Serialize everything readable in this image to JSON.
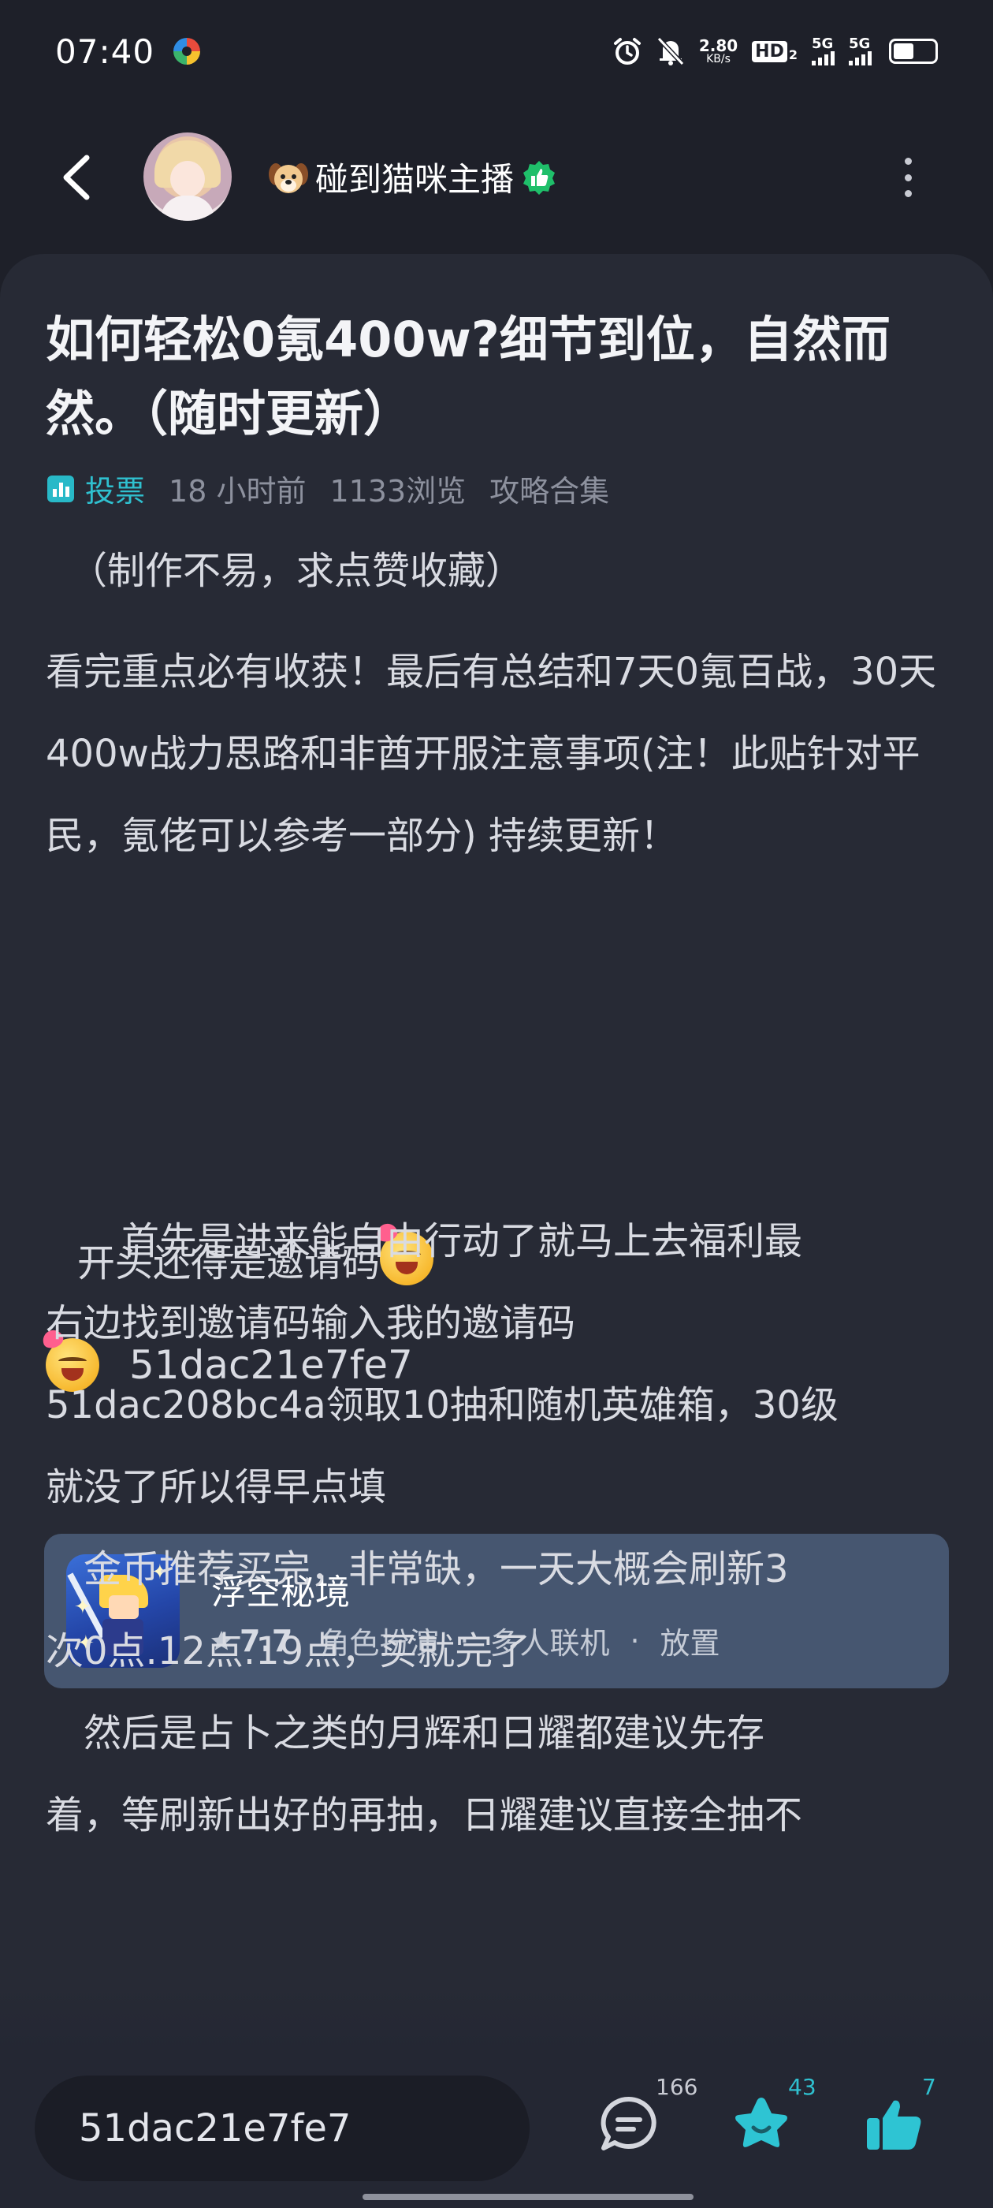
{
  "status_bar": {
    "time": "07:40",
    "net_speed_value": "2.80",
    "net_speed_unit": "KB/s",
    "hd_label": "HD",
    "hd_sub": "2",
    "signal1": "5G",
    "signal2": "5G",
    "battery_level": 0.5,
    "icons": [
      "app-icon",
      "alarm-icon",
      "mute-bell-icon",
      "signal-icon",
      "battery-icon"
    ]
  },
  "header": {
    "author_name": "碰到猫咪主播",
    "icons": [
      "back-arrow-icon",
      "avatar",
      "dog-emoji-icon",
      "verified-badge-icon",
      "more-vertical-icon"
    ]
  },
  "post": {
    "title": "如何轻松0氪400w?细节到位，自然而然。（随时更新）",
    "meta": {
      "type_label": "投票",
      "time": "18 小时前",
      "views": "1133浏览",
      "collection": "攻略合集"
    },
    "p1": "（制作不易，求点赞收藏）",
    "p2": "看完重点必有收获！最后有总结和7天0氪百战，30天400w战力思路和非酋开服注意事项(注！此贴针对平民，氪佬可以参考一部分) 持续更新！",
    "invite_intro": "开头还得是邀请码",
    "invite_code": "51dac21e7fe7",
    "p3_lines": [
      "　　首先是进来能自由行动了就马上去福利最",
      "右边找到邀请码输入我的邀请码",
      "51dac208bc4a领取10抽和随机英雄箱，30级",
      "就没了所以得早点填",
      "　金币推荐买完，非常缺，一天大概会刷新3",
      "次0点.12点.19点，买就完了",
      "　然后是占卜之类的月辉和日耀都建议先存",
      "着，等刷新出好的再抽，日耀建议直接全抽不"
    ]
  },
  "game_card": {
    "name": "浮空秘境",
    "rating": "7.7",
    "tags": [
      "角色扮演",
      "多人联机",
      "放置"
    ],
    "separator": "·"
  },
  "bottom_bar": {
    "input_value": "51dac21e7fe7",
    "comment_count": "166",
    "favorite_count": "43",
    "like_count": "7"
  },
  "colors": {
    "background": "#1e2029",
    "card": "#272a35",
    "accent": "#2fc0cf",
    "game_card": "#465670"
  }
}
